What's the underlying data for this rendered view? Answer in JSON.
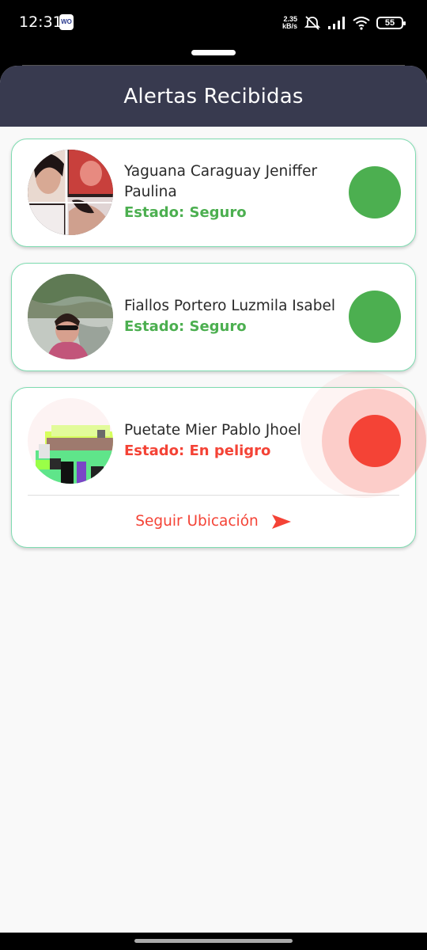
{
  "status_bar": {
    "time": "12:31",
    "app_badge": "WO",
    "net_speed_value": "2.35",
    "net_speed_unit": "kB/s",
    "battery": "55"
  },
  "header": {
    "title": "Alertas Recibidas"
  },
  "alerts": [
    {
      "name": "Yaguana Caraguay Jeniffer Paulina",
      "state": "Estado: Seguro",
      "status_color": "#4caf50"
    },
    {
      "name": "Fiallos Portero Luzmila Isabel",
      "state": "Estado: Seguro",
      "status_color": "#4caf50"
    },
    {
      "name": "Puetate Mier Pablo Jhoel",
      "state": "Estado: En peligro",
      "status_color": "#f44336",
      "action_label": "Seguir Ubicación"
    }
  ],
  "colors": {
    "safe": "#4caf50",
    "danger": "#f44336",
    "header_bg": "#383a4f",
    "card_border": "#7fdcb1"
  },
  "icons": [
    "wifi-icon",
    "signal-icon",
    "mute-icon",
    "battery-icon",
    "send-arrow-icon"
  ]
}
